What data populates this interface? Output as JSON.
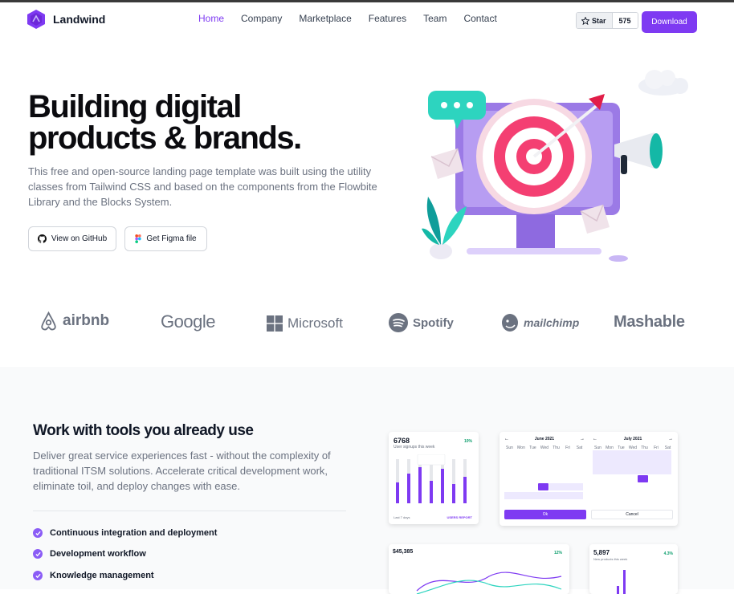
{
  "nav": {
    "brand": "Landwind",
    "links": [
      "Home",
      "Company",
      "Marketplace",
      "Features",
      "Team",
      "Contact"
    ],
    "star_label": "Star",
    "star_count": "575",
    "download_label": "Download"
  },
  "hero": {
    "title": "Building digital products & brands.",
    "description": "This free and open-source landing page template was built using the utility classes from Tailwind CSS and based on the components from the Flowbite Library and the Blocks System.",
    "btn_github": "View on GitHub",
    "btn_figma": "Get Figma file"
  },
  "logos": [
    "airbnb",
    "Google",
    "Microsoft",
    "Spotify",
    "mailchimp",
    "Mashable"
  ],
  "section": {
    "title": "Work with tools you already use",
    "description": "Deliver great service experiences fast - without the complexity of traditional ITSM solutions. Accelerate critical development work, eliminate toil, and deploy changes with ease.",
    "features": [
      "Continuous integration and deployment",
      "Development workflow",
      "Knowledge management"
    ]
  },
  "cards": {
    "users_value": "6768",
    "users_caption": "User signups this week",
    "users_change": "10%",
    "users_footer_left": "Last 7 days",
    "users_footer_right": "USERS REPORT",
    "cal_month1": "June 2021",
    "cal_month2": "July 2021",
    "weekdays": [
      "Sun",
      "Mon",
      "Tue",
      "Wed",
      "Thu",
      "Fri",
      "Sat"
    ],
    "cal_ok": "Ok",
    "cal_cancel": "Cancel",
    "sales_value": "$45,385",
    "sales_change": "12%",
    "sales2_value": "5,897",
    "sales2_caption": "New products this week",
    "sales2_change": "4.3%"
  },
  "colors": {
    "accent": "#7e3af2",
    "text": "#111827",
    "muted": "#6b7280"
  }
}
